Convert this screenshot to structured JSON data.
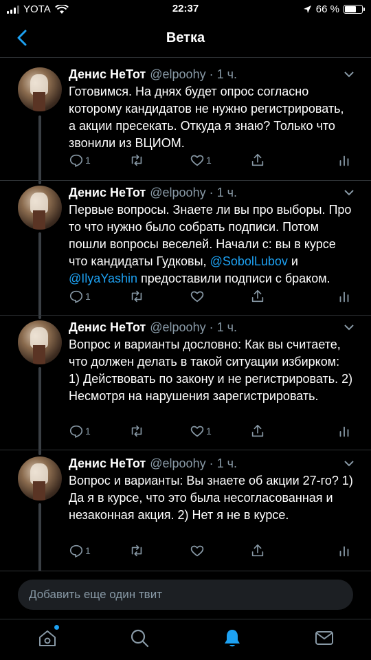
{
  "status_bar": {
    "carrier": "YOTA",
    "time": "22:37",
    "battery_percent": "66 %",
    "battery_level": 0.66
  },
  "header": {
    "title": "Ветка",
    "back_icon": "chevron-left-icon"
  },
  "tweets": [
    {
      "name": "Денис НеТот",
      "handle": "@elpoohy · 1 ч.",
      "text": "Готовимся. На днях будет опрос согласно которому кандидатов не нужно регистрировать, а акции пресекать. Откуда я знаю? Только что звонили из ВЦИОМ.",
      "reply_count": "1",
      "like_count": "1"
    },
    {
      "name": "Денис НеТот",
      "handle": "@elpoohy · 1 ч.",
      "text_parts": {
        "part1": "Первые вопросы. Знаете ли вы про выборы. Про то что нужно было собрать подписи. Потом пошли вопросы веселей. Начали с: вы в курсе что кандидаты Гудковы, ",
        "mention1": "@SobolLubov",
        "part2": " и ",
        "mention2": "@IlyaYashin",
        "part3": " предоставили подписи с браком."
      },
      "reply_count": "1",
      "like_count": ""
    },
    {
      "name": "Денис НеТот",
      "handle": "@elpoohy · 1 ч.",
      "text": "Вопрос и варианты дословно: Как вы считаете, что должен делать в такой ситуации избирком: 1) Действовать по закону и не регистрировать. 2) Несмотря на нарушения зарегистрировать.",
      "reply_count": "1",
      "like_count": "1"
    },
    {
      "name": "Денис НеТот",
      "handle": "@elpoohy · 1 ч.",
      "text": "Вопрос и варианты: Вы знаете об акции 27-го? 1) Да я в курсе, что это была несогласованная и незаконная акция. 2) Нет я не в курсе.",
      "reply_count": "1",
      "like_count": ""
    }
  ],
  "reply_box": {
    "placeholder": "Добавить еще один твит"
  },
  "tab_bar": {
    "items": [
      "home-icon",
      "search-icon",
      "notifications-bell-icon",
      "messages-envelope-icon"
    ],
    "active": "notifications-bell-icon",
    "accent_color": "#1da1f2"
  },
  "colors": {
    "background": "#000000",
    "secondary_text": "#8899a6",
    "accent": "#1da1f2",
    "divider": "#2f3336"
  }
}
